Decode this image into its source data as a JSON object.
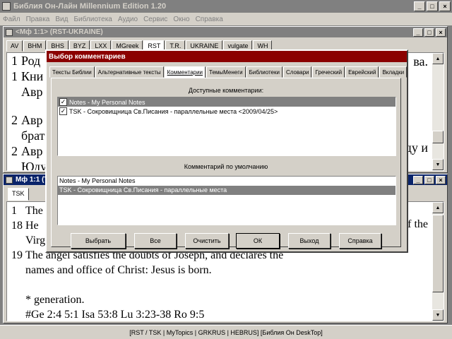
{
  "app": {
    "title": "Библия Он-Лайн Millennium Edition 1.20"
  },
  "menu": [
    "Файл",
    "Правка",
    "Вид",
    "Библиотека",
    "Аудио",
    "Сервис",
    "Окно",
    "Справка"
  ],
  "bible_window": {
    "title": "<Мф 1:1> (RST-UKRAINE)",
    "tabs": [
      "AV",
      "BHM",
      "BHS",
      "BYZ",
      "LXX",
      "MGreek",
      "RST",
      "T.R.",
      "UKRAINE",
      "vulgate",
      "WH"
    ],
    "selected_tab": "RST",
    "lines": [
      {
        "num": "1",
        "text": "Род"
      },
      {
        "num": "1",
        "text": "Кни"
      },
      {
        "num": "",
        "text": "Авр"
      },
      {
        "num": "2",
        "text": "Авр"
      },
      {
        "num": "",
        "text": "брат"
      },
      {
        "num": "2",
        "text": "Авр"
      },
      {
        "num": "",
        "text": "Юду"
      }
    ],
    "right_fragments": [
      "ва.",
      "ду и"
    ]
  },
  "tsk_window": {
    "title": "Мф 1:1 (TSK)",
    "tab": "TSK",
    "lines": [
      {
        "num": "1",
        "text": "The"
      },
      {
        "num": "18",
        "text": "He"
      },
      {
        "num": "",
        "text": "Virg"
      },
      {
        "num": "19",
        "text": "The angel satisfies the doubts of Joseph, and declares the"
      },
      {
        "num": "",
        "text": "names and office of Christ:  Jesus is born."
      },
      {
        "num": "",
        "text": ""
      },
      {
        "num": "",
        "text": "* generation."
      },
      {
        "num": "",
        "text": "#Ge 2:4 5:1 Isa 53:8 Lu 3:23-38 Ro 9:5"
      }
    ],
    "right_fragment": "f the"
  },
  "dialog": {
    "title": "Выбор комментариев",
    "tabs": [
      "Тексты Библии",
      "Альтернативные тексты",
      "Комментарии",
      "ТемыМенеги",
      "Библиотеки",
      "Словари",
      "Греческий",
      "Еврейский",
      "Вкладки"
    ],
    "selected_tab": "Комментарии",
    "available_label": "Доступные комментарии:",
    "available": [
      {
        "label": "Notes - My Personal Notes",
        "checked": true,
        "selected": true
      },
      {
        "label": "TSK - Сокровищница Св.Писания - параллельные места <2009/04/25>",
        "checked": true,
        "selected": false
      }
    ],
    "default_label": "Комментарий по умолчанию",
    "defaults": [
      {
        "label": "Notes - My Personal Notes",
        "selected": false
      },
      {
        "label": "TSK - Сокровищница Св.Писания - параллельные места",
        "selected": true
      }
    ],
    "buttons": [
      "Выбрать",
      "Все",
      "Очистить",
      "ОК",
      "Выход",
      "Справка"
    ]
  },
  "statusbar": "[RST / TSK | MyTopics | GRKRUS | HEBRUS]   [Библия Он DeskTop]"
}
